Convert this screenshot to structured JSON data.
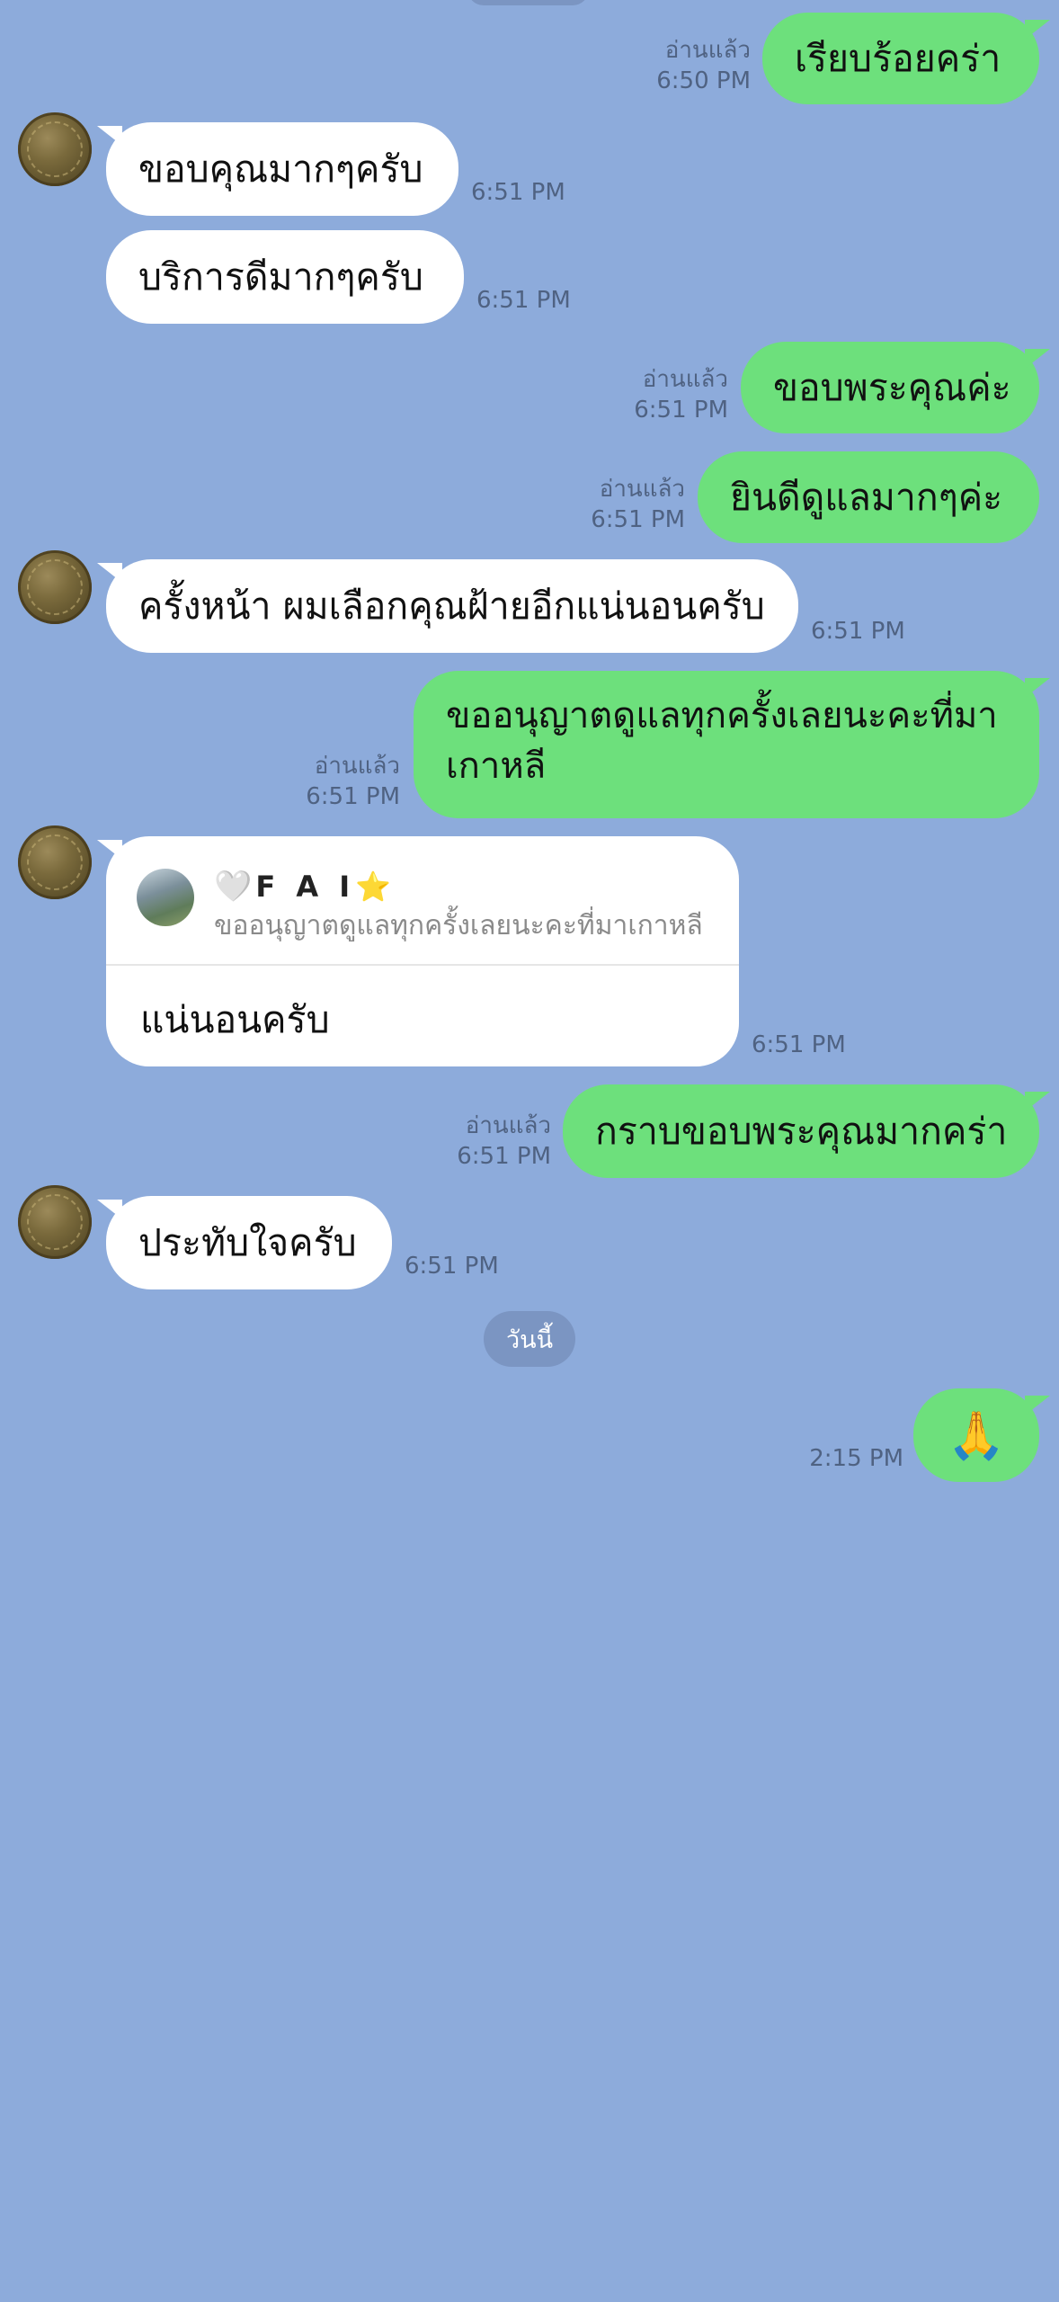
{
  "messages": {
    "m1": {
      "text": "เรียบร้อยคร่า",
      "read": "อ่านแล้ว",
      "time": "6:50 PM"
    },
    "m2": {
      "text": "ขอบคุณมากๆครับ",
      "time": "6:51 PM"
    },
    "m3": {
      "text": "บริการดีมากๆครับ",
      "time": "6:51 PM"
    },
    "m4": {
      "text": "ขอบพระคุณค่ะ",
      "read": "อ่านแล้ว",
      "time": "6:51 PM"
    },
    "m5": {
      "text": "ยินดีดูแลมากๆค่ะ",
      "read": "อ่านแล้ว",
      "time": "6:51 PM"
    },
    "m6": {
      "text": "ครั้งหน้า ผมเลือกคุณฝ้ายอีกแน่นอนครับ",
      "time": "6:51 PM"
    },
    "m7": {
      "text": "ขออนุญาตดูแลทุกครั้งเลยนะคะที่มาเกาหลี",
      "read": "อ่านแล้ว",
      "time": "6:51 PM"
    },
    "m8": {
      "reply_to_name": "F A I",
      "reply_to_prefix": "🤍",
      "reply_to_suffix": "⭐",
      "reply_to_text": "ขออนุญาตดูแลทุกครั้งเลยนะคะที่มาเกาหลี",
      "text": "แน่นอนครับ",
      "time": "6:51 PM"
    },
    "m9": {
      "text": "กราบขอบพระคุณมากคร่า",
      "read": "อ่านแล้ว",
      "time": "6:51 PM"
    },
    "m10": {
      "text": "ประทับใจครับ",
      "time": "6:51 PM"
    },
    "m11": {
      "text": "🙏",
      "time": "2:15 PM"
    }
  },
  "date_separator": "วันนี้",
  "colors": {
    "background": "#8dabdb",
    "outgoing_bubble": "#6de07c",
    "incoming_bubble": "#ffffff",
    "meta_text": "#4f6282"
  }
}
